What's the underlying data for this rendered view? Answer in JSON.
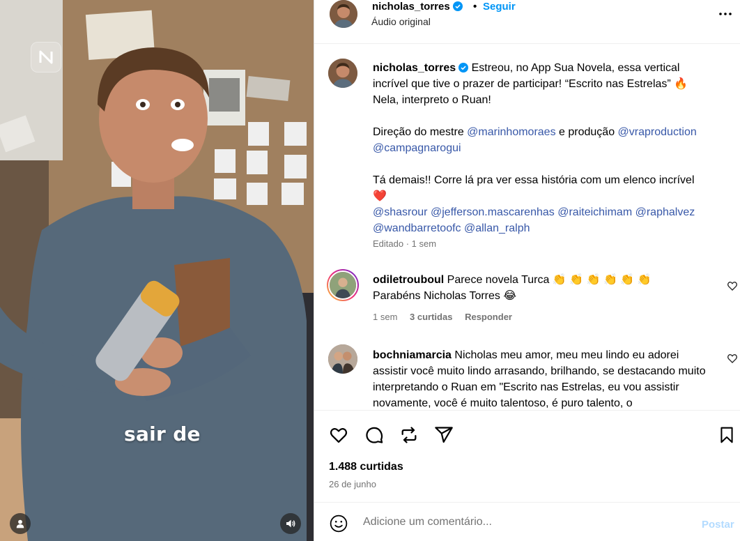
{
  "media": {
    "caption": "sair de",
    "icons": {
      "user_tag": "person-icon",
      "audio": "speaker-icon",
      "app_badge": "app-logo-icon"
    }
  },
  "header": {
    "username": "nicholas_torres",
    "separator": "•",
    "follow_label": "Seguir",
    "audio_label": "Áudio original",
    "more_icon": "more-options-icon"
  },
  "caption_post": {
    "username": "nicholas_torres",
    "text_1": "Estreou, no App Sua Novela, essa vertical incrível que tive o prazer de participar! “Escrito nas Estrelas”",
    "emoji_fire": "🔥",
    "text_2": "Nela, interpreto o Ruan!",
    "credits_prefix": "Direção do mestre",
    "mention_director": "@marinhomoraes",
    "credits_mid": "e produção",
    "mention_prod_1": "@vraproduction",
    "mention_prod_2": "@campagnarogui",
    "text_3": "Tá demais!! Corre lá pra ver essa história com um elenco incrível",
    "emoji_heart": "❤️",
    "mentions_cast": [
      "@shasrour",
      "@jefferson.mascarenhas",
      "@raiteichimam",
      "@raphalvez",
      "@wandbarretoofc",
      "@allan_ralph"
    ],
    "meta": "Editado · 1 sem"
  },
  "comments": [
    {
      "username": "odiletrouboul",
      "text": "Parece novela Turca 👏 👏 👏 👏 👏 👏",
      "text_2": "Parabéns Nicholas Torres 😂",
      "time": "1 sem",
      "likes": "3 curtidas",
      "reply": "Responder"
    },
    {
      "username": "bochniamarcia",
      "text": "Nicholas meu amor, meu meu lindo eu adorei assistir você muito lindo arrasando, brilhando, se destacando muito interpretando o Ruan em \"Escrito nas Estrelas, eu vou assistir novamente, você é muito talentoso, é puro talento, o"
    }
  ],
  "actions": {
    "like_icon": "heart-icon",
    "comment_icon": "comment-icon",
    "share_icon": "repost-icon",
    "send_icon": "send-icon",
    "save_icon": "bookmark-icon",
    "likes_count": "1.488 curtidas",
    "date": "26 de junho"
  },
  "comment_box": {
    "placeholder": "Adicione um comentário...",
    "post_label": "Postar",
    "emoji_icon": "smiley-icon"
  },
  "colors": {
    "accent": "#0095f6",
    "mention": "#3858a8",
    "muted": "#737373",
    "post_disabled": "#b3dbff"
  }
}
